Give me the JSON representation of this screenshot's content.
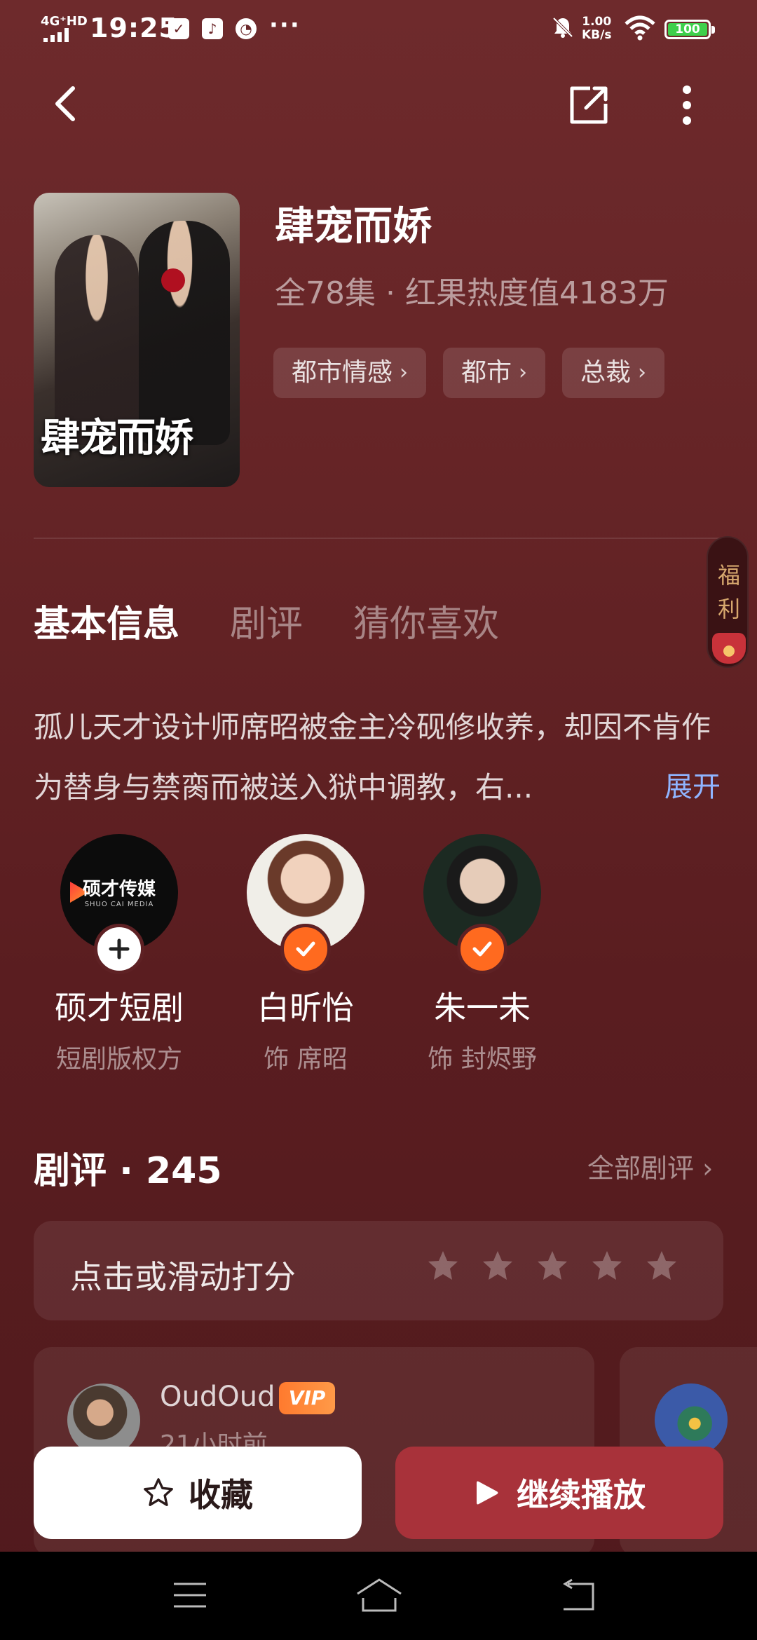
{
  "status_bar": {
    "network": "4G⁺HD",
    "time": "19:25",
    "more": "···",
    "speed_value": "1.00",
    "speed_unit": "KB/s",
    "battery": "100"
  },
  "drama": {
    "title": "肆宠而娇",
    "meta": "全78集 · 红果热度值4183万",
    "poster_title": "肆宠而娇",
    "tags": [
      "都市情感",
      "都市",
      "总裁"
    ]
  },
  "side_benefit": {
    "label": "福利"
  },
  "tabs": [
    "基本信息",
    "剧评",
    "猜你喜欢"
  ],
  "description": {
    "text": "孤儿天才设计师席昭被金主冷砚修收养，却因不肯作为替身与禁脔而被送入狱中调教，右...",
    "expand_label": "展开"
  },
  "people": [
    {
      "name": "硕才短剧",
      "role": "短剧版权方",
      "logo_text": "硕才传媒",
      "logo_sub": "SHUO CAI MEDIA",
      "badge": "plus"
    },
    {
      "name": "白昕怡",
      "role": "饰 席昭",
      "badge": "check"
    },
    {
      "name": "朱一未",
      "role": "饰 封烬野",
      "badge": "check"
    }
  ],
  "reviews": {
    "title": "剧评 · 245",
    "all_label": "全部剧评",
    "rate_prompt": "点击或滑动打分",
    "star_count": 5,
    "cards": [
      {
        "user": "OudOud",
        "vip": "VIP",
        "time": "21小时前"
      }
    ]
  },
  "actions": {
    "favorite_label": "收藏",
    "play_label": "继续播放"
  },
  "colors": {
    "accent_orange": "#ff6a1f",
    "play_button": "#a8323a",
    "link_blue": "#8fb4ff",
    "background": "#652426"
  }
}
